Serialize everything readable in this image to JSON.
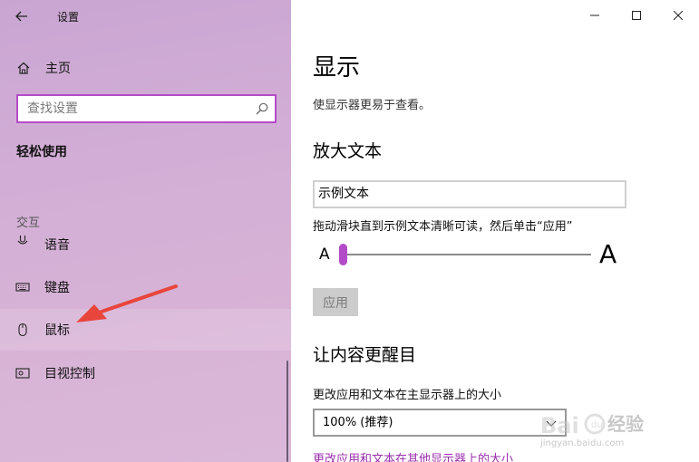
{
  "window": {
    "title": "设置",
    "controls": [
      "minimize",
      "maximize",
      "close"
    ]
  },
  "sidebar": {
    "home_label": "主页",
    "search_placeholder": "查找设置",
    "section_heading": "轻松使用",
    "group_label": "交互",
    "items": [
      {
        "label": "语音",
        "icon": "microphone-icon",
        "partial": true
      },
      {
        "label": "键盘",
        "icon": "keyboard-icon"
      },
      {
        "label": "鼠标",
        "icon": "mouse-icon",
        "highlighted": true
      },
      {
        "label": "目视控制",
        "icon": "eye-control-icon"
      }
    ]
  },
  "main": {
    "title": "显示",
    "subtitle": "使显示器更易于查看。",
    "enlarge_text": {
      "title": "放大文本",
      "sample_text": "示例文本",
      "hint": "拖动滑块直到示例文本清晰可读，然后单击“应用”",
      "small_a": "A",
      "big_a": "A",
      "slider_value": 0.0,
      "apply_label": "应用"
    },
    "make_bigger": {
      "title": "让内容更醒目",
      "size_label": "更改应用和文本在主显示器上的大小",
      "size_value": "100% (推荐)",
      "other_link": "更改应用和文本在其他显示器上的大小"
    }
  },
  "watermark": {
    "brand": "经验",
    "url": "jingyan.baidu.com"
  },
  "colors": {
    "accent": "#b54bc8",
    "sidebar_bg": "#d2aed6",
    "annotation_arrow": "#e8453c"
  }
}
